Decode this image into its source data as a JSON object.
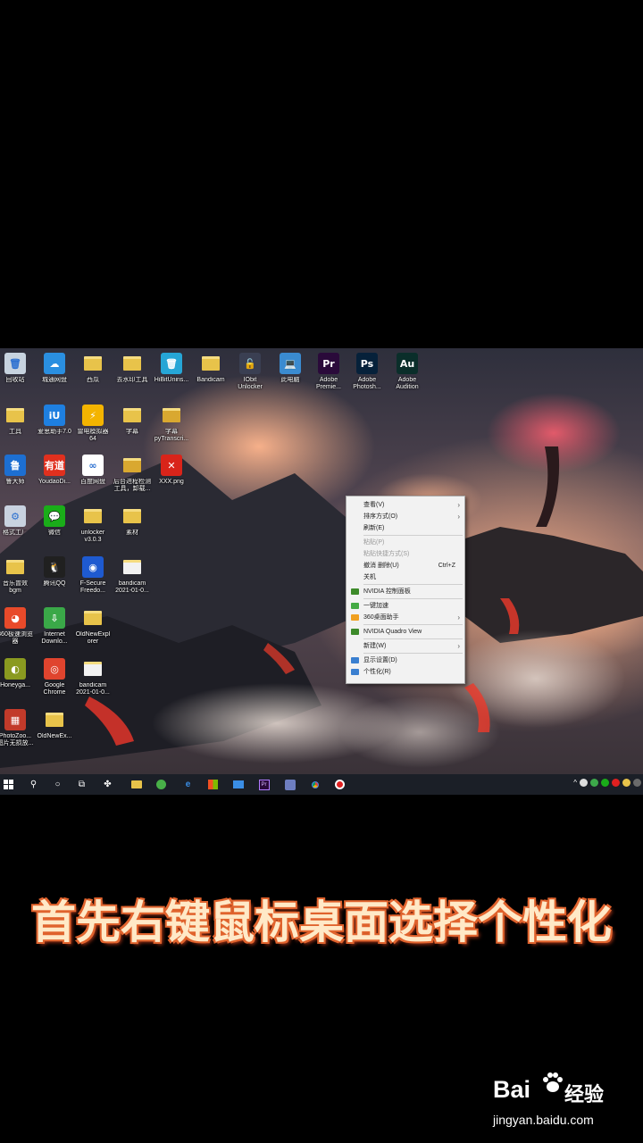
{
  "desktop_icons": [
    {
      "label": "回收站",
      "glyph": "🗑",
      "color": "#c7d3df"
    },
    {
      "label": "城通网盘",
      "glyph": "☁",
      "color": "#2a8fe0"
    },
    {
      "label": "西瓜",
      "glyph": "",
      "color": "#e8c34a"
    },
    {
      "label": "去水印工具",
      "glyph": "",
      "color": "#e8c34a"
    },
    {
      "label": "HiBitUnins...",
      "glyph": "🗑",
      "color": "#26a6d6"
    },
    {
      "label": "Bandicam",
      "glyph": "",
      "color": "#e8c34a"
    },
    {
      "label": "IObit\nUnlocker",
      "glyph": "🔓",
      "color": "#3a3f52"
    },
    {
      "label": "此电脑",
      "glyph": "💻",
      "color": "#3a8bd0"
    },
    {
      "label": "Adobe\nPremie...",
      "glyph": "Pr",
      "color": "#2a0a3a"
    },
    {
      "label": "Adobe\nPhotosh...",
      "glyph": "Ps",
      "color": "#06213a"
    },
    {
      "label": "Adobe\nAudition",
      "glyph": "Au",
      "color": "#0a2e2a"
    },
    {
      "label": "工具",
      "glyph": "",
      "color": "#e8c34a"
    },
    {
      "label": "爱思助手7.0",
      "glyph": "iU",
      "color": "#1e7fe0"
    },
    {
      "label": "雷电模拟器\n64",
      "glyph": "⚡",
      "color": "#f4b400"
    },
    {
      "label": "字幕",
      "glyph": "",
      "color": "#e8c34a"
    },
    {
      "label": "字幕\npyTranscri...",
      "glyph": "",
      "color": "#d9a830"
    },
    {
      "label": "鲁大师",
      "glyph": "鲁",
      "color": "#1d6fd1"
    },
    {
      "label": "YoudaoDi...",
      "glyph": "有道",
      "color": "#e0301e"
    },
    {
      "label": "百度网盘",
      "glyph": "∞",
      "color": "#ffffff"
    },
    {
      "label": "后台进程检测\n工具，卸载...",
      "glyph": "",
      "color": "#d9a830"
    },
    {
      "label": "XXX.png",
      "glyph": "✕",
      "color": "#d9241a"
    },
    {
      "label": "格式工厂",
      "glyph": "⚙",
      "color": "#c9d2e0"
    },
    {
      "label": "微信",
      "glyph": "💬",
      "color": "#1aad19"
    },
    {
      "label": "unlocker\nv3.0.3",
      "glyph": "",
      "color": "#e8c34a"
    },
    {
      "label": "素材",
      "glyph": "",
      "color": "#e8c34a"
    },
    {
      "label": "音乐曾效\nbgm",
      "glyph": "",
      "color": "#e8c34a"
    },
    {
      "label": "腾讯QQ",
      "glyph": "🐧",
      "color": "#202020"
    },
    {
      "label": "F-Secure\nFreedo...",
      "glyph": "◉",
      "color": "#1e5ad0"
    },
    {
      "label": "bandicam\n2021-01-0...",
      "glyph": "",
      "color": "#f2f2f2"
    },
    {
      "label": "360极速浏览\n器",
      "glyph": "◕",
      "color": "#e84a2a"
    },
    {
      "label": "Internet\nDownlo...",
      "glyph": "⇩",
      "color": "#3aa848"
    },
    {
      "label": "OldNewExpl\norer",
      "glyph": "",
      "color": "#e8c34a"
    },
    {
      "label": "Honeyga...",
      "glyph": "◐",
      "color": "#8a9a20"
    },
    {
      "label": "Google\nChrome",
      "glyph": "◎",
      "color": "#e0442e"
    },
    {
      "label": "bandicam\n2021-01-0...",
      "glyph": "",
      "color": "#f2f2f2"
    },
    {
      "label": "PhotoZoo...\n图片无损放...",
      "glyph": "▦",
      "color": "#c23a2a"
    },
    {
      "label": "OldNewEx...",
      "glyph": "",
      "color": "#e8c34a"
    }
  ],
  "context_menu": {
    "items": [
      {
        "label": "查看(V)",
        "arrow": "›",
        "type": "normal"
      },
      {
        "label": "排序方式(O)",
        "arrow": "›",
        "type": "normal"
      },
      {
        "label": "刷新(E)",
        "type": "normal"
      },
      {
        "type": "sep"
      },
      {
        "label": "粘贴(P)",
        "type": "disabled"
      },
      {
        "label": "粘贴快捷方式(S)",
        "type": "disabled"
      },
      {
        "label": "撤消 删除(U)",
        "shortcut": "Ctrl+Z",
        "type": "normal"
      },
      {
        "label": "关机",
        "type": "normal"
      },
      {
        "type": "sep"
      },
      {
        "label": "NVIDIA 控制面板",
        "type": "normal",
        "mi": "#3d8a2a"
      },
      {
        "type": "sep"
      },
      {
        "label": "一键加速",
        "type": "normal",
        "mi": "#44aa44"
      },
      {
        "label": "360桌面助手",
        "arrow": "›",
        "type": "normal",
        "mi": "#f0a020"
      },
      {
        "type": "sep"
      },
      {
        "label": "NVIDIA Quadro View",
        "type": "normal",
        "mi": "#3d8a2a"
      },
      {
        "type": "sep"
      },
      {
        "label": "新建(W)",
        "arrow": "›",
        "type": "normal"
      },
      {
        "type": "sep"
      },
      {
        "label": "显示设置(D)",
        "type": "normal",
        "mi": "#3a7fd0"
      },
      {
        "label": "个性化(R)",
        "type": "normal",
        "mi": "#3a7fd0"
      }
    ]
  },
  "caption": "首先右键鼠标桌面选择个性化",
  "watermark": {
    "brand": "Bai",
    "brand_cn": "经验",
    "url": "jingyan.baidu.com"
  }
}
